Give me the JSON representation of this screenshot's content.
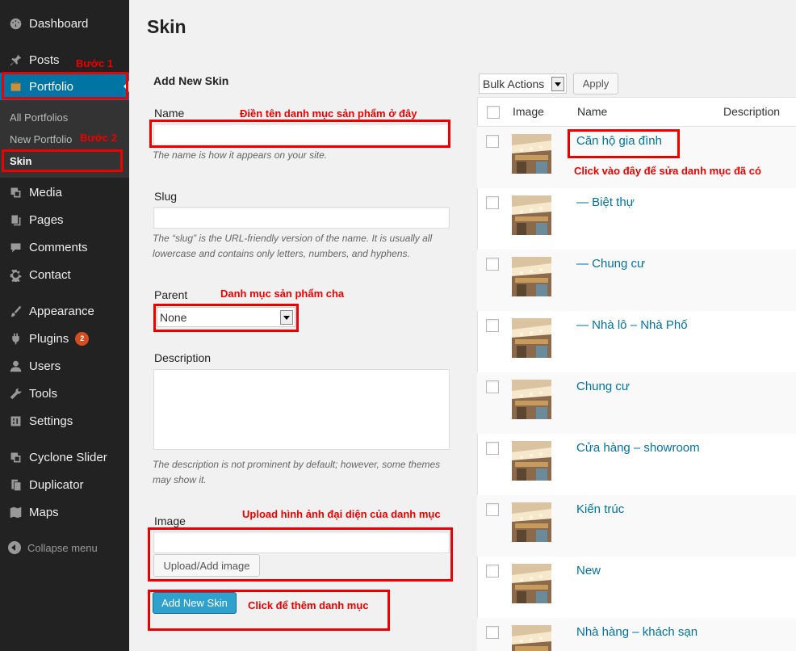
{
  "sidebar": {
    "items": [
      {
        "label": "Dashboard",
        "icon": "dashboard-icon"
      },
      {
        "label": "Posts",
        "icon": "pin-icon"
      },
      {
        "label": "Portfolio",
        "icon": "portfolio-icon"
      },
      {
        "label": "Media",
        "icon": "media-icon"
      },
      {
        "label": "Pages",
        "icon": "pages-icon"
      },
      {
        "label": "Comments",
        "icon": "comment-icon"
      },
      {
        "label": "Contact",
        "icon": "gear-icon"
      },
      {
        "label": "Appearance",
        "icon": "brush-icon"
      },
      {
        "label": "Plugins",
        "icon": "plug-icon",
        "badge": "2"
      },
      {
        "label": "Users",
        "icon": "user-icon"
      },
      {
        "label": "Tools",
        "icon": "wrench-icon"
      },
      {
        "label": "Settings",
        "icon": "settings-icon"
      },
      {
        "label": "Cyclone Slider",
        "icon": "media-icon"
      },
      {
        "label": "Duplicator",
        "icon": "duplicate-icon"
      },
      {
        "label": "Maps",
        "icon": "map-icon"
      }
    ],
    "submenu": [
      "All Portfolios",
      "New Portfolio",
      "Skin"
    ],
    "collapse": "Collapse menu"
  },
  "page": {
    "title": "Skin"
  },
  "form": {
    "title": "Add New Skin",
    "name_label": "Name",
    "name_value": "",
    "name_help": "The name is how it appears on your site.",
    "slug_label": "Slug",
    "slug_value": "",
    "slug_help": "The “slug” is the URL-friendly version of the name. It is usually all lowercase and contains only letters, numbers, and hyphens.",
    "parent_label": "Parent",
    "parent_value": "None",
    "description_label": "Description",
    "description_help": "The description is not prominent by default; however, some themes may show it.",
    "image_label": "Image",
    "upload_button": "Upload/Add image",
    "submit_button": "Add New Skin"
  },
  "annotations": {
    "step1": "Bước 1",
    "step2": "Bước 2",
    "name_note": "Điền tên danh mục sản phẩm ở đây",
    "parent_note": "Danh mục sản phẩm cha",
    "image_note": "Upload hình ảnh đại diện của danh mục",
    "submit_note": "Click để thêm danh mục",
    "edit_note": "Click vào đây để sửa danh mục đã có",
    "color": "#e00000"
  },
  "table": {
    "bulk_action": "Bulk Actions",
    "apply": "Apply",
    "columns": [
      "Image",
      "Name",
      "Description"
    ],
    "rows": [
      {
        "name": "Căn hộ gia đình"
      },
      {
        "name": "— Biệt thự"
      },
      {
        "name": "— Chung cư"
      },
      {
        "name": "— Nhà lô – Nhà Phố"
      },
      {
        "name": "Chung cư"
      },
      {
        "name": "Cửa hàng – showroom"
      },
      {
        "name": "Kiến trúc"
      },
      {
        "name": "New"
      },
      {
        "name": "Nhà hàng – khách sạn"
      }
    ]
  },
  "colors": {
    "sidebar_bg": "#222222",
    "active": "#0074a2",
    "link": "#0074a2",
    "primary_button": "#2ea2cc"
  }
}
